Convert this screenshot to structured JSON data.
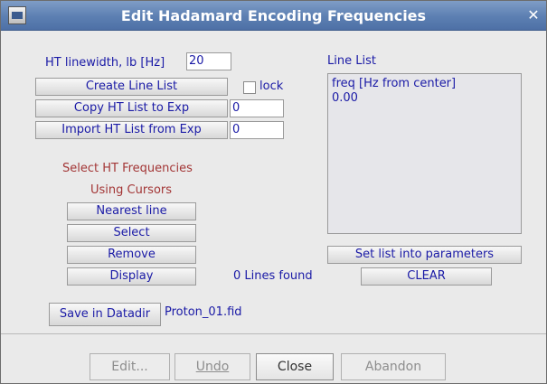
{
  "window": {
    "title": "Edit Hadamard Encoding Frequencies"
  },
  "controls": {
    "linewidth_label": "HT linewidth, lb [Hz]",
    "linewidth_value": "20",
    "create_line_list": "Create Line List",
    "lock_label": "lock",
    "lock_checked": false,
    "copy_ht_list": "Copy HT List to Exp",
    "copy_value": "0",
    "import_ht_list": "Import HT List from Exp",
    "import_value": "0",
    "select_heading_1": "Select HT Frequencies",
    "select_heading_2": "Using Cursors",
    "nearest_line": "Nearest line",
    "select": "Select",
    "remove": "Remove",
    "display": "Display",
    "lines_found": "0 Lines found",
    "save_in_datadir": "Save in Datadir",
    "filename": "Proton_01.fid"
  },
  "line_list": {
    "label": "Line List",
    "header": "freq [Hz from center]",
    "values": [
      "0.00"
    ],
    "set_list_button": "Set list into parameters",
    "clear_button": "CLEAR"
  },
  "bottom": {
    "edit": "Edit...",
    "undo": "Undo",
    "close": "Close",
    "abandon": "Abandon"
  }
}
